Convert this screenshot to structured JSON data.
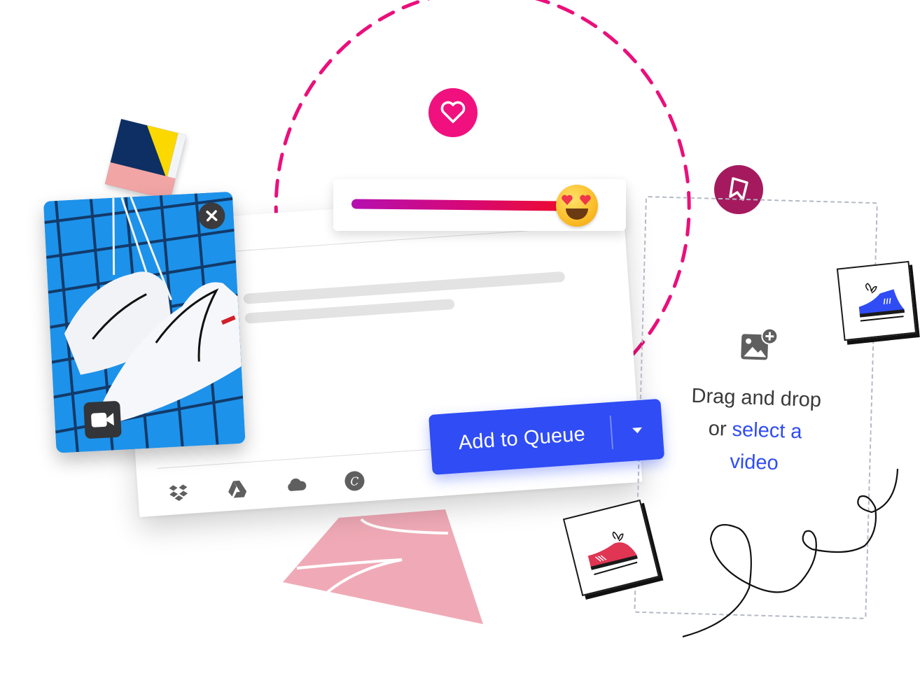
{
  "composer": {
    "sources": [
      {
        "name": "dropbox-icon",
        "label": "Dropbox"
      },
      {
        "name": "google-drive-icon",
        "label": "Google Drive"
      },
      {
        "name": "cloud-icon",
        "label": "Cloud"
      },
      {
        "name": "canva-icon",
        "label": "Canva",
        "glyph": "C"
      }
    ],
    "placeholder_lines": 2
  },
  "reaction_slider": {
    "value_percent": 95,
    "emoji": "heart-eyes",
    "gradient_colors": [
      "#b40fb0",
      "#d5087a",
      "#ee0b2c"
    ]
  },
  "badges": {
    "heart": {
      "icon": "heart-icon",
      "color": "#f0117e"
    },
    "bookmark": {
      "icon": "bookmark-icon",
      "color": "#a51a5e"
    }
  },
  "media_preview": {
    "type": "video",
    "close_icon": "close-icon",
    "type_icon": "video-camera-icon"
  },
  "queue_button": {
    "label": "Add to Queue",
    "menu_icon": "caret-down-icon",
    "color": "#2f4cf5"
  },
  "dropzone": {
    "icon": "add-image-icon",
    "line1": "Drag and drop",
    "line2_prefix": "or ",
    "link_text_a": "select a",
    "link_text_b": "video",
    "link_color": "#2f4cf5"
  },
  "colors": {
    "accent_pink": "#f0117e",
    "triangle_pink": "#f0aab7",
    "sticker_blue": "#2f4cf5",
    "sticker_red": "#e03553"
  }
}
